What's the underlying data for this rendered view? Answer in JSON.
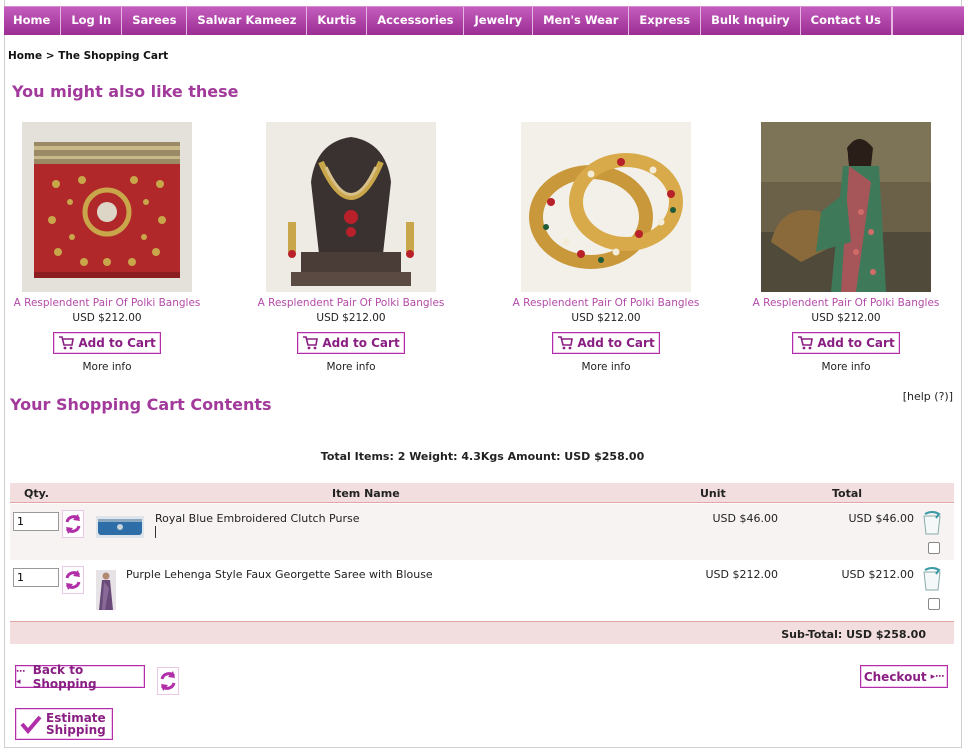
{
  "nav": {
    "items": [
      "Home",
      "Log In",
      "Sarees",
      "Salwar Kameez",
      "Kurtis",
      "Accessories",
      "Jewelry",
      "Men's Wear",
      "Express",
      "Bulk Inquiry",
      "Contact Us"
    ]
  },
  "breadcrumb": {
    "home": "Home",
    "separator": ">",
    "current": "The Shopping Cart"
  },
  "suggestions": {
    "title": "You might also like these",
    "products": [
      {
        "name": "A Resplendent Pair Of Polki Bangles",
        "price": "USD $212.00",
        "add_label": "Add to Cart",
        "more_label": "More info"
      },
      {
        "name": "A Resplendent Pair Of Polki Bangles",
        "price": "USD $212.00",
        "add_label": "Add to Cart",
        "more_label": "More info"
      },
      {
        "name": "A Resplendent Pair Of Polki Bangles",
        "price": "USD $212.00",
        "add_label": "Add to Cart",
        "more_label": "More info"
      },
      {
        "name": "A Resplendent Pair Of Polki Bangles",
        "price": "USD $212.00",
        "add_label": "Add to Cart",
        "more_label": "More info"
      }
    ]
  },
  "cart": {
    "title": "Your Shopping Cart Contents",
    "help": "[help (?)]",
    "summary": "Total Items: 2  Weight: 4.3Kgs  Amount: USD $258.00",
    "headers": {
      "qty": "Qty.",
      "item": "Item Name",
      "unit": "Unit",
      "total": "Total"
    },
    "items": [
      {
        "qty": "1",
        "name": "Royal Blue Embroidered Clutch Purse",
        "unit": "USD $46.00",
        "total": "USD $46.00"
      },
      {
        "qty": "1",
        "name": "Purple Lehenga Style Faux Georgette Saree with Blouse",
        "unit": "USD $212.00",
        "total": "USD $212.00"
      }
    ],
    "subtotal": "Sub-Total: USD $258.00"
  },
  "actions": {
    "back": "Back to Shopping",
    "checkout": "Checkout",
    "estimate_line1": "Estimate",
    "estimate_line2": "Shipping"
  },
  "colors": {
    "brand": "#a23a9b",
    "nav": "#b048a8",
    "row_alt": "#f2dede"
  }
}
